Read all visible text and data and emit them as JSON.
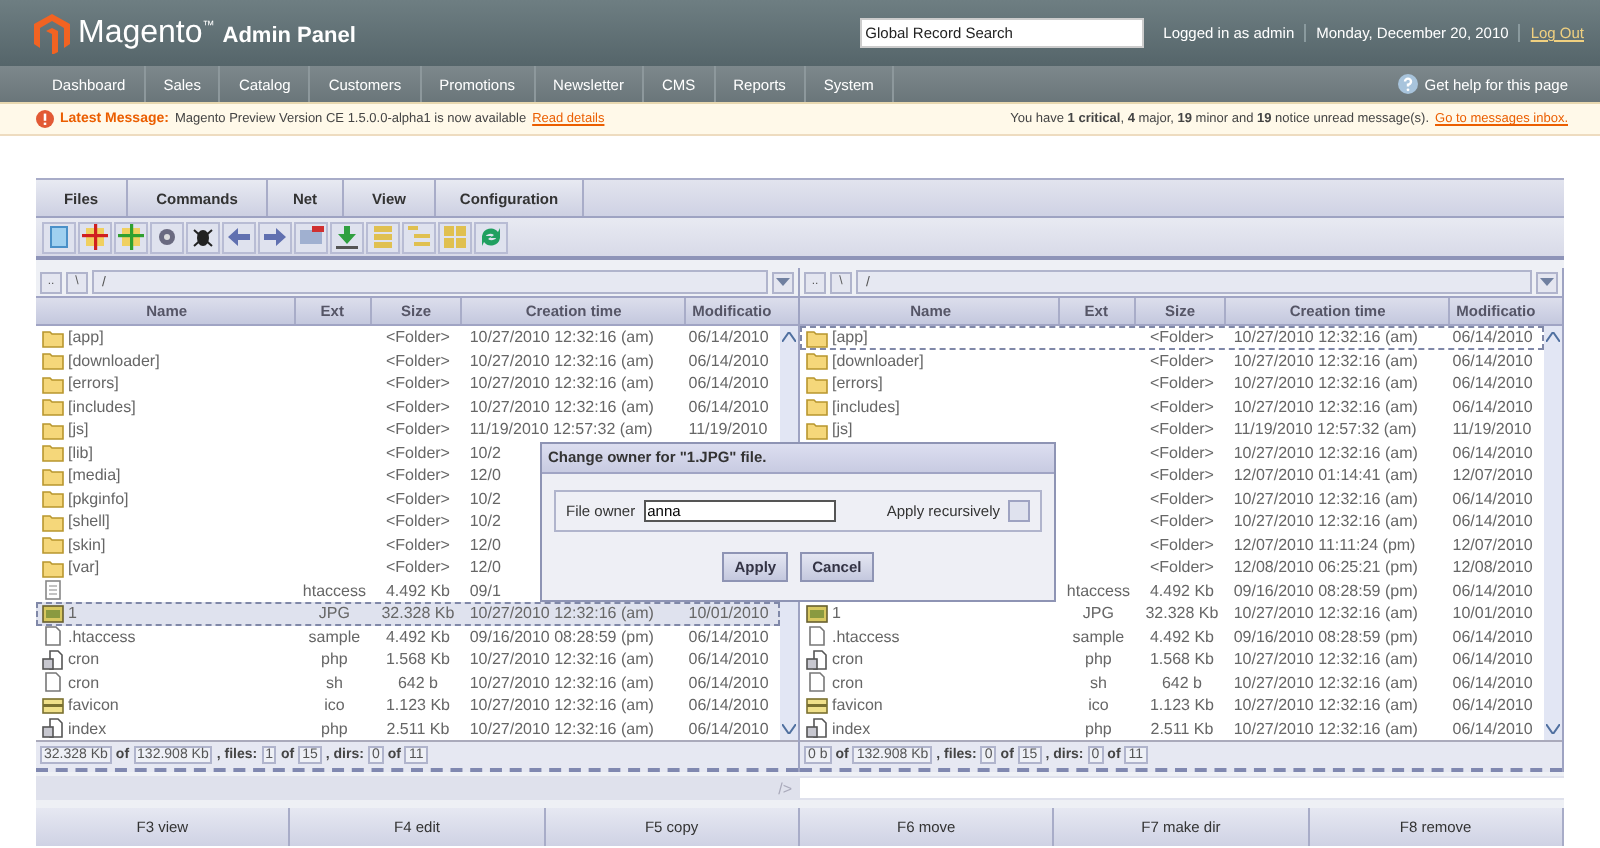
{
  "header": {
    "logo": "Magento$^{™}$",
    "subtitle": "Admin Panel",
    "search": {
      "value": "Global Record Search"
    },
    "user": "Logged in as admin",
    "date": "Monday, December 20, 2010",
    "logout": "Log Out"
  },
  "nav": [
    "Dashboard",
    "Sales",
    "Catalog",
    "Customers",
    "Promotions",
    "Newsletter",
    "CMS",
    "Reports",
    "System"
  ],
  "help": "Get help for this page",
  "message": {
    "label": "Latest Message:",
    "text": "Magento Preview Version CE 1.5.0.0-alpha1 is now available",
    "link": "Read details",
    "summary": "You have **1 critical**, **4** major, **19** minor and **19** notice unread message(s).",
    "inbox": "Go to messages inbox."
  },
  "menu": [
    "Files",
    "Commands",
    "Net",
    "View",
    "Configuration"
  ],
  "panels": [
    {
      "path_buttons": [
        "..",
        "\\"
      ],
      "path": "/",
      "columns": [
        "Name",
        "Ext",
        "Size",
        "Creation time",
        "Modificatio"
      ],
      "rows": [
        {
          "kind": "folder",
          "name": "[app]",
          "size": "<Folder>",
          "created": "10/27/2010 12:32:16 (am)",
          "modified": "06/14/2010",
          "selected": false,
          "focused": false
        },
        {
          "kind": "folder",
          "name": "[downloader]",
          "size": "<Folder>",
          "created": "10/27/2010 12:32:16 (am)",
          "modified": "06/14/2010",
          "selected": false,
          "focused": false
        },
        {
          "kind": "folder",
          "name": "[errors]",
          "size": "<Folder>",
          "created": "10/27/2010 12:32:16 (am)",
          "modified": "06/14/2010",
          "selected": false,
          "focused": false
        },
        {
          "kind": "folder",
          "name": "[includes]",
          "size": "<Folder>",
          "created": "10/27/2010 12:32:16 (am)",
          "modified": "06/14/2010",
          "selected": false,
          "focused": false
        },
        {
          "kind": "folder",
          "name": "[js]",
          "size": "<Folder>",
          "created": "11/19/2010 12:57:32 (am)",
          "modified": "11/19/2010",
          "selected": false,
          "focused": false
        },
        {
          "kind": "folder",
          "name": "[lib]",
          "size": "<Folder>",
          "created": "10/2",
          "selected": false,
          "focused": false
        },
        {
          "kind": "folder",
          "name": "[media]",
          "size": "<Folder>",
          "created": "12/0",
          "selected": false,
          "focused": false
        },
        {
          "kind": "folder",
          "name": "[pkginfo]",
          "size": "<Folder>",
          "created": "10/2",
          "selected": false,
          "focused": false
        },
        {
          "kind": "folder",
          "name": "[shell]",
          "size": "<Folder>",
          "created": "10/2",
          "selected": false,
          "focused": false
        },
        {
          "kind": "folder",
          "name": "[skin]",
          "size": "<Folder>",
          "created": "12/0",
          "selected": false,
          "focused": false
        },
        {
          "kind": "folder",
          "name": "[var]",
          "size": "<Folder>",
          "created": "12/0",
          "selected": false,
          "focused": false
        },
        {
          "kind": "text",
          "ext": "htaccess",
          "size": "4.492 Kb",
          "created": "09/1",
          "selected": false,
          "focused": false
        },
        {
          "kind": "image",
          "name": "1",
          "ext": "JPG",
          "size": "32.328 Kb",
          "created": "10/27/2010 12:32:16 (am)",
          "modified": "10/01/2010",
          "selected": true,
          "focused": true
        },
        {
          "kind": "plain",
          "name": ".htaccess",
          "ext": "sample",
          "size": "4.492 Kb",
          "created": "09/16/2010 08:28:59 (pm)",
          "modified": "06/14/2010",
          "selected": false,
          "focused": false
        },
        {
          "kind": "script",
          "name": "cron",
          "ext": "php",
          "size": "1.568 Kb",
          "created": "10/27/2010 12:32:16 (am)",
          "modified": "06/14/2010",
          "selected": false,
          "focused": false
        },
        {
          "kind": "plain",
          "name": "cron",
          "ext": "sh",
          "size": "642 b",
          "created": "10/27/2010 12:32:16 (am)",
          "modified": "06/14/2010",
          "selected": false,
          "focused": false
        },
        {
          "kind": "ico",
          "name": "favicon",
          "ext": "ico",
          "size": "1.123 Kb",
          "created": "10/27/2010 12:32:16 (am)",
          "modified": "06/14/2010",
          "selected": false,
          "focused": false
        },
        {
          "kind": "script",
          "name": "index",
          "ext": "php",
          "size": "2.511 Kb",
          "created": "10/27/2010 12:32:16 (am)",
          "modified": "06/14/2010",
          "selected": false,
          "focused": false
        }
      ],
      "status": [
        {
          "kind": "value",
          "text": "32.328 Kb"
        },
        {
          "kind": "label",
          "text": "of"
        },
        {
          "kind": "value",
          "text": "132.908 Kb"
        },
        {
          "kind": "label",
          "text": ", files:"
        },
        {
          "kind": "value",
          "text": "1"
        },
        {
          "kind": "label",
          "text": "of"
        },
        {
          "kind": "value",
          "text": "15"
        },
        {
          "kind": "label",
          "text": ", dirs:"
        },
        {
          "kind": "value",
          "text": "0"
        },
        {
          "kind": "label",
          "text": "of"
        },
        {
          "kind": "value",
          "text": "11"
        }
      ]
    },
    {
      "path_buttons": [
        "..",
        "\\"
      ],
      "path": "/",
      "columns": [
        "Name",
        "Ext",
        "Size",
        "Creation time",
        "Modificatio"
      ],
      "rows": [
        {
          "kind": "folder",
          "name": "[app]",
          "size": "<Folder>",
          "created": "10/27/2010 12:32:16 (am)",
          "modified": "06/14/2010",
          "selected": false,
          "focused": true
        },
        {
          "kind": "folder",
          "name": "[downloader]",
          "size": "<Folder>",
          "created": "10/27/2010 12:32:16 (am)",
          "modified": "06/14/2010",
          "selected": false,
          "focused": false
        },
        {
          "kind": "folder",
          "name": "[errors]",
          "size": "<Folder>",
          "created": "10/27/2010 12:32:16 (am)",
          "modified": "06/14/2010",
          "selected": false,
          "focused": false
        },
        {
          "kind": "folder",
          "name": "[includes]",
          "size": "<Folder>",
          "created": "10/27/2010 12:32:16 (am)",
          "modified": "06/14/2010",
          "selected": false,
          "focused": false
        },
        {
          "kind": "folder",
          "name": "[js]",
          "size": "<Folder>",
          "created": "11/19/2010 12:57:32 (am)",
          "modified": "11/19/2010",
          "selected": false,
          "focused": false
        },
        {
          "size": "<Folder>",
          "created": "10/27/2010 12:32:16 (am)",
          "modified": "06/14/2010",
          "selected": false,
          "focused": false
        },
        {
          "size": "<Folder>",
          "created": "12/07/2010 01:14:41 (am)",
          "modified": "12/07/2010",
          "selected": false,
          "focused": false
        },
        {
          "size": "<Folder>",
          "created": "10/27/2010 12:32:16 (am)",
          "modified": "06/14/2010",
          "selected": false,
          "focused": false
        },
        {
          "size": "<Folder>",
          "created": "10/27/2010 12:32:16 (am)",
          "modified": "06/14/2010",
          "selected": false,
          "focused": false
        },
        {
          "size": "<Folder>",
          "created": "12/07/2010 11:11:24 (pm)",
          "modified": "12/07/2010",
          "selected": false,
          "focused": false
        },
        {
          "size": "<Folder>",
          "created": "12/08/2010 06:25:21 (pm)",
          "modified": "12/08/2010",
          "selected": false,
          "focused": false
        },
        {
          "ext": "htaccess",
          "size": "4.492 Kb",
          "created": "09/16/2010 08:28:59 (pm)",
          "modified": "06/14/2010",
          "selected": false,
          "focused": false
        },
        {
          "kind": "image",
          "name": "1",
          "ext": "JPG",
          "size": "32.328 Kb",
          "created": "10/27/2010 12:32:16 (am)",
          "modified": "10/01/2010",
          "selected": false,
          "focused": false
        },
        {
          "kind": "plain",
          "name": ".htaccess",
          "ext": "sample",
          "size": "4.492 Kb",
          "created": "09/16/2010 08:28:59 (pm)",
          "modified": "06/14/2010",
          "selected": false,
          "focused": false
        },
        {
          "kind": "script",
          "name": "cron",
          "ext": "php",
          "size": "1.568 Kb",
          "created": "10/27/2010 12:32:16 (am)",
          "modified": "06/14/2010",
          "selected": false,
          "focused": false
        },
        {
          "kind": "plain",
          "name": "cron",
          "ext": "sh",
          "size": "642 b",
          "created": "10/27/2010 12:32:16 (am)",
          "modified": "06/14/2010",
          "selected": false,
          "focused": false
        },
        {
          "kind": "ico",
          "name": "favicon",
          "ext": "ico",
          "size": "1.123 Kb",
          "created": "10/27/2010 12:32:16 (am)",
          "modified": "06/14/2010",
          "selected": false,
          "focused": false
        },
        {
          "kind": "script",
          "name": "index",
          "ext": "php",
          "size": "2.511 Kb",
          "created": "10/27/2010 12:32:16 (am)",
          "modified": "06/14/2010",
          "selected": false,
          "focused": false
        }
      ],
      "status": [
        {
          "kind": "value",
          "text": "0 b"
        },
        {
          "kind": "label",
          "text": "of"
        },
        {
          "kind": "value",
          "text": "132.908 Kb"
        },
        {
          "kind": "label",
          "text": ", files:"
        },
        {
          "kind": "value",
          "text": "0"
        },
        {
          "kind": "label",
          "text": "of"
        },
        {
          "kind": "value",
          "text": "15"
        },
        {
          "kind": "label",
          "text": ", dirs:"
        },
        {
          "kind": "value",
          "text": "0"
        },
        {
          "kind": "label",
          "text": "of"
        },
        {
          "kind": "value",
          "text": "11"
        }
      ]
    }
  ],
  "dialog": {
    "title": "Change owner for \"1.JPG\" file.",
    "owner_label": "File owner",
    "owner_value": "anna",
    "recursive_label": "Apply recursively",
    "recursive_checked": false,
    "buttons": [
      "Apply",
      "Cancel"
    ]
  },
  "command_prompt": "/>",
  "function_keys": [
    "F3 view",
    "F4 edit",
    "F5 copy",
    "F6 move",
    "F7 make dir",
    "F8 remove"
  ]
}
